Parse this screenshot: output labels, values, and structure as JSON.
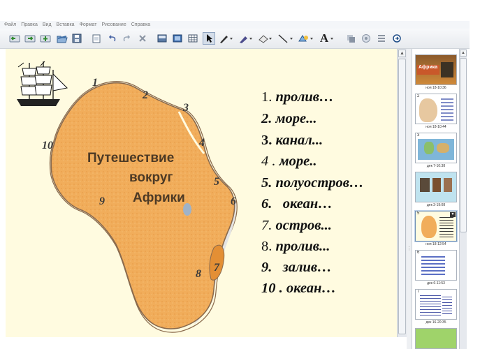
{
  "menu": {
    "items": [
      "Файл",
      "Правка",
      "Вид",
      "Вставка",
      "Формат",
      "Рисование",
      "Справка"
    ]
  },
  "toolbar": {
    "buttons": [
      "back-icon",
      "forward-icon",
      "add-page-icon",
      "open-icon",
      "save-icon",
      "paste-icon",
      "undo-icon",
      "redo-icon",
      "delete-icon",
      "screen-shade-icon",
      "full-screen-icon",
      "table-icon",
      "select-icon",
      "pen-icon",
      "highlighter-icon",
      "eraser-icon",
      "line-icon",
      "shapes-icon",
      "text-icon",
      "fill-icon",
      "properties-icon",
      "more-icon"
    ],
    "text_tool_label": "A"
  },
  "canvas": {
    "map_title": [
      "Путешествие",
      "вокруг",
      "Африки"
    ],
    "map_numbers": [
      "1",
      "2",
      "3",
      "4",
      "5",
      "6",
      "7",
      "8",
      "9",
      "10"
    ],
    "questions": [
      {
        "num": "1.",
        "word": "пролив…"
      },
      {
        "num": "2.",
        "word": "море..."
      },
      {
        "num": "3.",
        "word": "канал..."
      },
      {
        "num": "4 .",
        "word": "море.."
      },
      {
        "num": "5.",
        "word": "полуостров…"
      },
      {
        "num": "6.",
        "word": "  океан…"
      },
      {
        "num": "7.",
        "word": "остров..."
      },
      {
        "num": "8.",
        "word": "пролив..."
      },
      {
        "num": "9.",
        "word": "  залив…"
      },
      {
        "num": "10 .",
        "word": "океан…"
      }
    ]
  },
  "sorter": {
    "pages": [
      {
        "num": "",
        "time": "ноя 18-10:36",
        "label": "Африка"
      },
      {
        "num": "2",
        "time": "ноя 18-10:44"
      },
      {
        "num": "3",
        "time": "дек 7-10:38"
      },
      {
        "num": "4",
        "time": "дек 3-19:08"
      },
      {
        "num": "5",
        "time": "ноя 18-12:54"
      },
      {
        "num": "6",
        "time": "дек 6-11:53"
      },
      {
        "num": "7",
        "time": "дек 16-20:35"
      }
    ]
  },
  "colors": {
    "canvas_bg": "#fffbe0",
    "land": "#f1ad5b",
    "land_border": "#8a6a4d",
    "sea": "#e4e4e4"
  }
}
